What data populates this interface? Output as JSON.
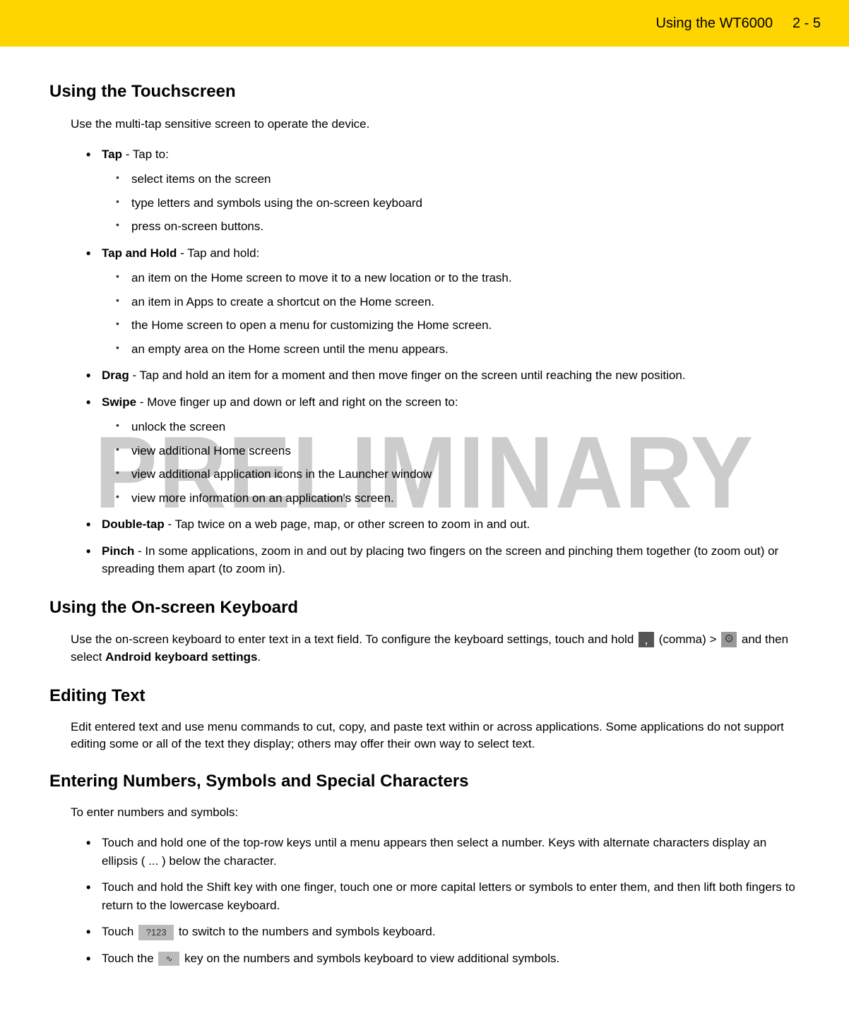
{
  "header": {
    "title": "Using the WT6000",
    "page": "2 - 5"
  },
  "watermark": "PRELIMINARY",
  "sections": {
    "touchscreen": {
      "heading": "Using the Touchscreen",
      "intro": "Use the multi-tap sensitive screen to operate the device.",
      "items": [
        {
          "bold": "Tap",
          "text": " - Tap to:",
          "sub": [
            "select items on the screen",
            "type letters and symbols using the on-screen keyboard",
            "press on-screen buttons."
          ]
        },
        {
          "bold": "Tap and Hold",
          "text": " - Tap and hold:",
          "sub": [
            "an item on the Home screen to move it to a new location or to the trash.",
            "an item in Apps to create a shortcut on the Home screen.",
            "the Home screen to open a menu for customizing the Home screen.",
            "an empty area on the Home screen until the menu appears."
          ]
        },
        {
          "bold": "Drag",
          "text": " - Tap and hold an item for a moment and then move finger on the screen until reaching the new position."
        },
        {
          "bold": "Swipe",
          "text": " - Move finger up and down or left and right on the screen to:",
          "sub": [
            "unlock the screen",
            "view additional Home screens",
            "view additional application icons in the Launcher window",
            "view more information on an application's screen."
          ]
        },
        {
          "bold": "Double-tap",
          "text": " - Tap twice on a web page, map, or other screen to zoom in and out."
        },
        {
          "bold": "Pinch",
          "text": " - In some applications, zoom in and out by placing two fingers on the screen and pinching them together (to zoom out) or spreading them apart (to zoom in)."
        }
      ]
    },
    "keyboard": {
      "heading": "Using the On-screen Keyboard",
      "intro_a": "Use the on-screen keyboard to enter text in a text field. To configure the keyboard settings, touch and hold ",
      "intro_b": " (comma) > ",
      "intro_c": " and then select ",
      "bold_setting": "Android keyboard settings",
      "intro_d": "."
    },
    "editing": {
      "heading": "Editing Text",
      "intro": "Edit entered text and use menu commands to cut, copy, and paste text within or across applications. Some applications do not support editing some or all of the text they display; others may offer their own way to select text."
    },
    "numbers": {
      "heading": "Entering Numbers, Symbols and Special Characters",
      "intro": "To enter numbers and symbols:",
      "items": [
        "Touch and hold one of the top-row keys until a menu appears then select a number. Keys with alternate characters display an ellipsis ( ... ) below the character.",
        "Touch and hold the Shift key with one finger, touch one or more capital letters or symbols to enter them, and then lift both fingers to return to the lowercase keyboard."
      ],
      "item3_a": "Touch ",
      "item3_b": " to switch to the numbers and symbols keyboard.",
      "item4_a": "Touch the ",
      "item4_b": " key on the numbers and symbols keyboard to view additional symbols."
    }
  },
  "icons": {
    "comma": ",",
    "gear": "⚙",
    "key123": "?123",
    "sym": "∿"
  }
}
